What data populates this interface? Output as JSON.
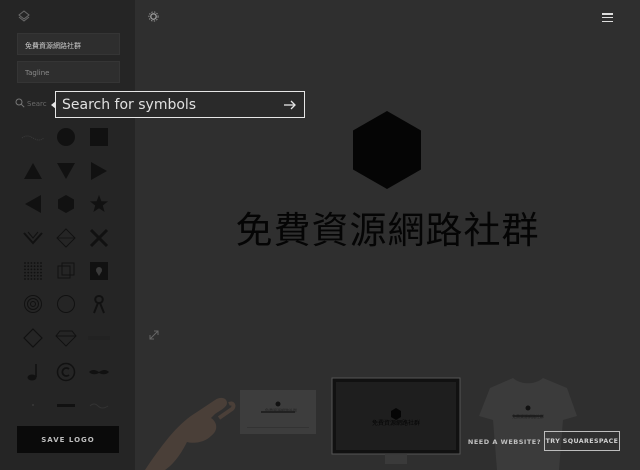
{
  "sidebar": {
    "company_name": "免費資源網路社群",
    "tagline_placeholder": "Tagline",
    "search_label_fragment": "Searc",
    "icons": [
      "wave-dots-icon",
      "circle-icon",
      "square-icon",
      "triangle-up-icon",
      "triangle-down-icon",
      "triangle-right-icon",
      "triangle-left-icon",
      "hexagon-icon",
      "star-icon",
      "chevron-leaves-icon",
      "diamond-outline-icon",
      "x-icon",
      "dot-grid-icon",
      "cube-icon",
      "map-pin-icon",
      "rings-icon",
      "circle-outline-icon",
      "ribbon-icon",
      "diamond-line-icon",
      "gem-icon",
      "text-badge-icon",
      "music-note-icon",
      "copyright-icon",
      "mustache-icon",
      "dots-icon",
      "crown-text-icon",
      "script-text-icon"
    ],
    "save_label": "SAVE LOGO"
  },
  "main": {
    "logo_text": "免費資源網路社群",
    "card_text": "免費資源網路社群",
    "shirt_text": "免費資源網路社群",
    "website_cta": "NEED A WEBSITE?",
    "try_label": "TRY SQUARESPACE"
  },
  "search": {
    "placeholder": "Search for symbols"
  },
  "colors": {
    "overlay_bg": "#2f2f2f",
    "sidebar_bg": "#252525",
    "logo_black": "#050505",
    "border_light": "#e6e6e6"
  }
}
